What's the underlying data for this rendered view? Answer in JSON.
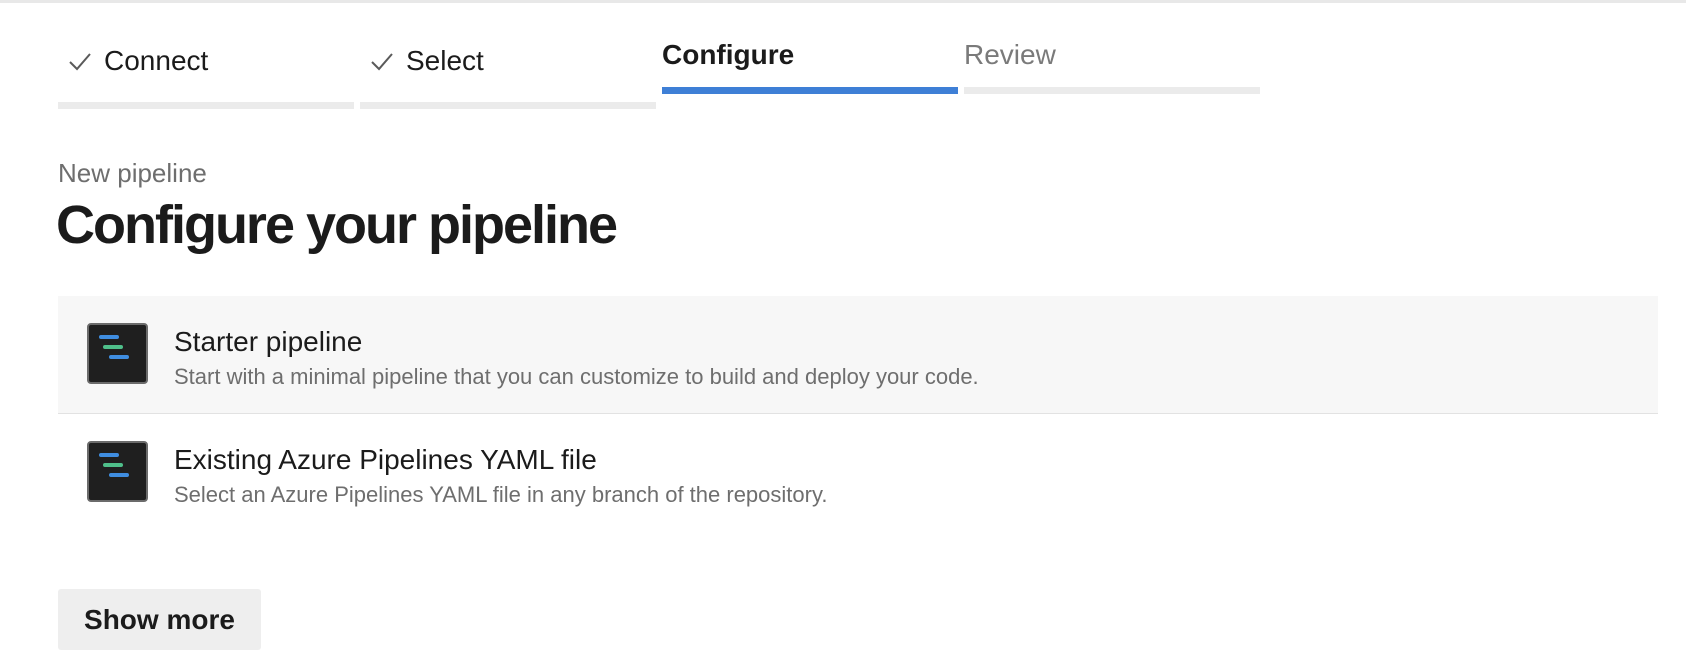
{
  "wizard": {
    "steps": [
      {
        "label": "Connect",
        "state": "done",
        "icon": "check-icon"
      },
      {
        "label": "Select",
        "state": "done",
        "icon": "check-icon"
      },
      {
        "label": "Configure",
        "state": "current"
      },
      {
        "label": "Review",
        "state": "todo"
      }
    ],
    "accent_color": "#3e7fd6"
  },
  "header": {
    "subtitle": "New pipeline",
    "title": "Configure your pipeline"
  },
  "options": [
    {
      "title": "Starter pipeline",
      "description": "Start with a minimal pipeline that you can customize to build and deploy your code.",
      "icon": "pipeline-icon",
      "highlighted": true
    },
    {
      "title": "Existing Azure Pipelines YAML file",
      "description": "Select an Azure Pipelines YAML file in any branch of the repository.",
      "icon": "pipeline-icon",
      "highlighted": false
    }
  ],
  "actions": {
    "show_more_label": "Show more"
  }
}
